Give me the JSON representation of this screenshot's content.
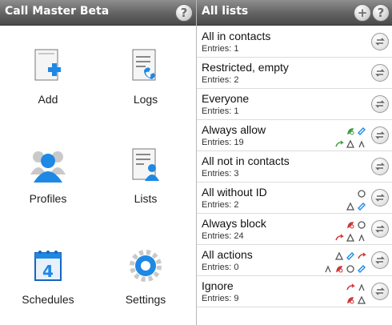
{
  "left_panel": {
    "title": "Call Master Beta",
    "help_icon": "question-mark-icon",
    "help_glyph": "?",
    "tiles": [
      {
        "label": "Add",
        "icon": "add-list-icon"
      },
      {
        "label": "Logs",
        "icon": "call-log-icon"
      },
      {
        "label": "Profiles",
        "icon": "profiles-people-icon"
      },
      {
        "label": "Lists",
        "icon": "contact-list-icon"
      },
      {
        "label": "Schedules",
        "icon": "calendar-icon"
      },
      {
        "label": "Settings",
        "icon": "gear-icon"
      }
    ]
  },
  "right_panel": {
    "title": "All lists",
    "add_glyph": "+",
    "help_glyph": "?",
    "lists": [
      {
        "name": "All in contacts",
        "entries": "Entries: 1",
        "indicators": []
      },
      {
        "name": "Restricted, empty",
        "entries": "Entries: 2",
        "indicators": []
      },
      {
        "name": "Everyone",
        "entries": "Entries: 1",
        "indicators": []
      },
      {
        "name": "Always allow",
        "entries": "Entries: 19",
        "indicators": [
          "green-call-icon",
          "blue-sms-icon",
          "green-forward-icon",
          "blocked-icon",
          "voicemail-icon"
        ]
      },
      {
        "name": "All not in contacts",
        "entries": "Entries: 3",
        "indicators": []
      },
      {
        "name": "All without ID",
        "entries": "Entries: 2",
        "indicators": [
          "reject-icon",
          "blocked-icon",
          "blue-sms-icon"
        ]
      },
      {
        "name": "Always block",
        "entries": "Entries: 24",
        "indicators": [
          "red-call-icon",
          "reject-icon",
          "red-hangup-icon",
          "blocked-icon",
          "voicemail-icon"
        ]
      },
      {
        "name": "All actions",
        "entries": "Entries: 0",
        "indicators": [
          "blocked-icon",
          "blue-sms-icon",
          "red-hangup-icon",
          "voicemail-icon",
          "red-call-icon",
          "reject-icon",
          "blue-sms-icon"
        ]
      },
      {
        "name": "Ignore",
        "entries": "Entries: 9",
        "indicators": [
          "red-hangup-icon",
          "voicemail-icon",
          "red-call-icon",
          "blocked-icon"
        ]
      }
    ]
  },
  "colors": {
    "titlebar_top": "#8e8e8e",
    "titlebar_bottom": "#4a4a4a",
    "icon_blue": "#1e88e5",
    "icon_green": "#3a9b3a",
    "icon_red": "#c83232"
  }
}
